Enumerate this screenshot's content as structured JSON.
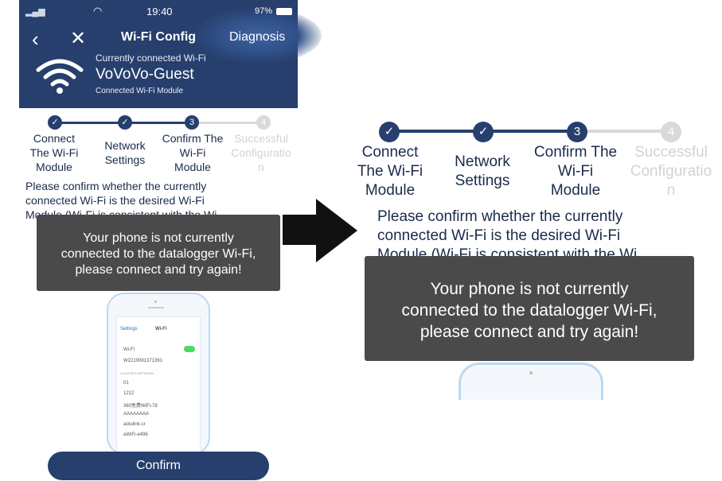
{
  "status_bar": {
    "time": "19:40",
    "battery": "97%"
  },
  "header": {
    "title": "Wi-Fi Config",
    "diagnosis_label": "Diagnosis",
    "currently_connected_label": "Currently connected Wi-Fi",
    "ssid": "VoVoVo-Guest",
    "module_label": "Connected Wi-Fi Module"
  },
  "steps": [
    {
      "number": "1",
      "label_lines": [
        "Connect",
        "The Wi-Fi",
        "Module"
      ],
      "state": "done"
    },
    {
      "number": "2",
      "label_lines": [
        "Network",
        "Settings"
      ],
      "state": "done"
    },
    {
      "number": "3",
      "label_lines": [
        "Confirm The",
        "Wi-Fi",
        "Module"
      ],
      "state": "current"
    },
    {
      "number": "4",
      "label_lines": [
        "Successful",
        "Configuratio",
        "n"
      ],
      "state": "pending"
    }
  ],
  "body": {
    "line1": "Please confirm whether the currently",
    "line2": "connected Wi-Fi is the desired Wi-Fi",
    "line3": "Module (Wi-Fi is consistent with the Wi"
  },
  "toast": {
    "line1": "Your phone is not currently",
    "line2": "connected to the datalogger Wi-Fi,",
    "line3": "please connect and try again!"
  },
  "confirm_label": "Confirm",
  "phone_mock": {
    "back_label": "Settings",
    "title": "Wi-Fi",
    "wifi_label": "Wi-Fi",
    "connected_network": "W2219081371361",
    "choose_label": "CHOOSE A NETWORK...",
    "networks": [
      "01",
      "1212",
      "360免费WiFi-78",
      "AAAAAAAA",
      "aotulink-cr",
      "aWiFi-e496"
    ]
  },
  "colors": {
    "primary": "#263f6d",
    "toast": "#4a4a4a",
    "inactive": "#d9d9d9"
  }
}
